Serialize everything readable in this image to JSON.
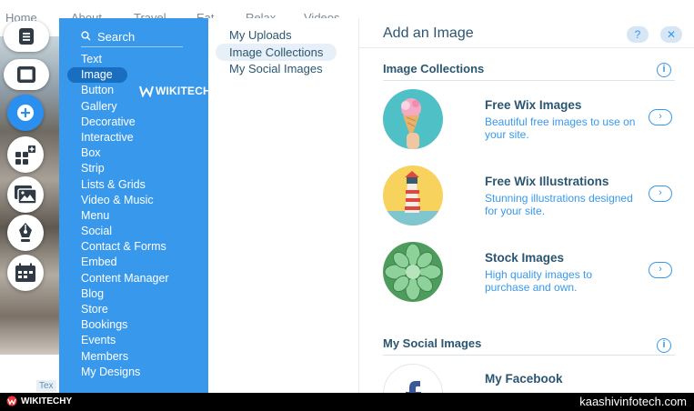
{
  "site_nav": [
    "Home",
    "About",
    "Travel",
    "Eat",
    "Relax",
    "Videos"
  ],
  "site_text_tab": "Tex",
  "rail": [
    {
      "icon": "pages-icon"
    },
    {
      "icon": "background-icon"
    },
    {
      "icon": "add-icon"
    },
    {
      "icon": "add-apps-icon"
    },
    {
      "icon": "media-icon"
    },
    {
      "icon": "blog-pen-icon"
    },
    {
      "icon": "bookings-icon"
    }
  ],
  "categories": {
    "search_label": "Search",
    "items": [
      "Text",
      "Image",
      "Button",
      "Gallery",
      "Decorative",
      "Interactive",
      "Box",
      "Strip",
      "Lists & Grids",
      "Video & Music",
      "Menu",
      "Social",
      "Contact & Forms",
      "Embed",
      "Content Manager",
      "Blog",
      "Store",
      "Bookings",
      "Events",
      "Members",
      "My Designs"
    ],
    "active_index": 1
  },
  "subcategories": {
    "items": [
      "My Uploads",
      "Image Collections",
      "My Social Images"
    ],
    "active_index": 1
  },
  "main": {
    "title": "Add an Image",
    "help_label": "?",
    "close_label": "✕",
    "section1": {
      "title": "Image Collections",
      "info": "i"
    },
    "collections": [
      {
        "title": "Free Wix Images",
        "desc": "Beautiful free images to use on your site.",
        "arrow": "›"
      },
      {
        "title": "Free Wix Illustrations",
        "desc": "Stunning illustrations designed for your site.",
        "arrow": "›"
      },
      {
        "title": "Stock Images",
        "desc": "High quality images to purchase and own.",
        "arrow": "›"
      }
    ],
    "section2": {
      "title": "My Social Images",
      "info": "i"
    },
    "social": [
      {
        "title": "My Facebook",
        "arrow": "›"
      }
    ]
  },
  "watermark": {
    "text": "WIKITECHY"
  },
  "bottom_bar": {
    "left": "WIKITECHY",
    "right": "kaashivinfotech.com"
  },
  "colors": {
    "panel_blue": "#3899ec",
    "active_blue": "#1a6ec0",
    "text_dark": "#2b5672"
  }
}
